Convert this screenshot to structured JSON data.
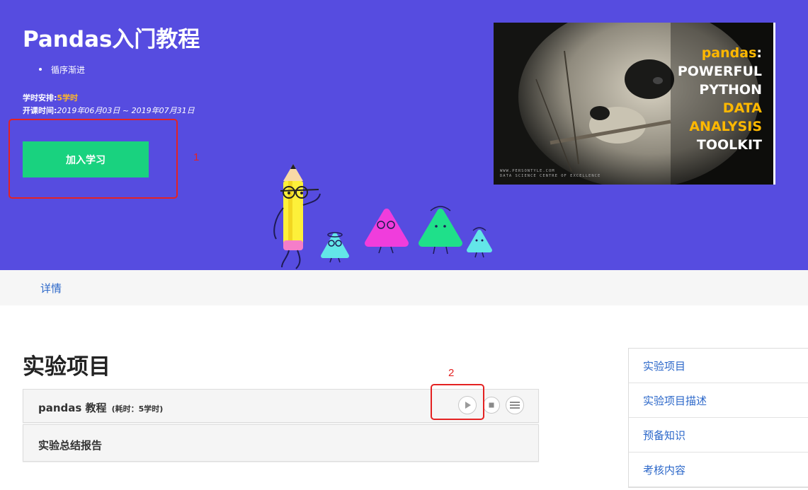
{
  "hero": {
    "title": "Pandas入门教程",
    "bullets": [
      "循序渐进"
    ],
    "hours_label": "学时安排:",
    "hours_value": "5学时",
    "open_label": "开课时间:",
    "open_value": "2019年06月03日 ~ 2019年07月31日",
    "join_button": "加入学习",
    "bg_color": "#564ce0",
    "button_color": "#19d27f"
  },
  "annotations": {
    "label_1": "1",
    "label_2": "2",
    "color": "#e42222"
  },
  "banner": {
    "line1_a": "pandas",
    "line1_b": ":",
    "line2": "POWERFUL",
    "line3": "PYTHON",
    "line4": "DATA",
    "line5": "ANALYSIS",
    "line6": "TOOLKIT",
    "foot1": "WWW.PERSONTYLE.COM",
    "foot2": "DATA SCIENCE CENTRE OF EXCELLENCE"
  },
  "tabs": {
    "detail": "详情"
  },
  "main": {
    "section_title": "实验项目",
    "labs": [
      {
        "name": "pandas 教程",
        "time": "(耗时：5学时)"
      },
      {
        "name": "实验总结报告"
      }
    ],
    "controls": [
      "play-icon",
      "stop-icon",
      "menu-icon"
    ]
  },
  "sidebar": {
    "items": [
      {
        "label": "实验项目"
      },
      {
        "label": "实验项目描述"
      },
      {
        "label": "预备知识"
      },
      {
        "label": "考核内容"
      }
    ]
  }
}
